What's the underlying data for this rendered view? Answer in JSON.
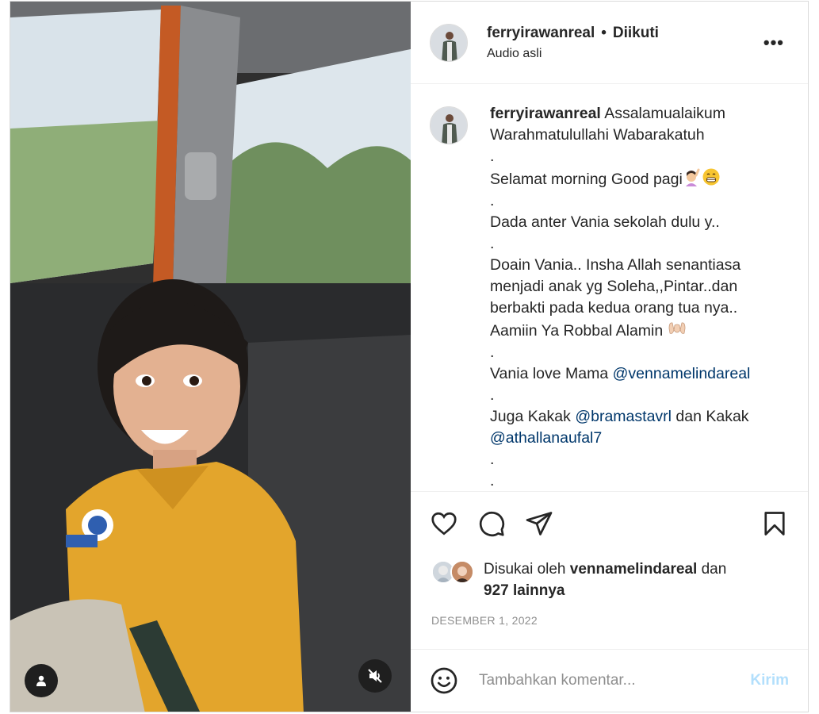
{
  "header": {
    "username": "ferryirawanreal",
    "separator": "•",
    "follow_label": "Diikuti",
    "subtitle": "Audio asli",
    "more_label": "•••"
  },
  "caption": {
    "username": "ferryirawanreal",
    "line1": "Assalamualaikum",
    "line2": "Warahmatulullahi Wabarakatuh",
    "dot1": ".",
    "line3": "Selamat morning Good pagi",
    "dot2": ".",
    "line4": "Dada anter Vania sekolah dulu y..",
    "dot3": ".",
    "line5": "Doain Vania.. Insha Allah senantiasa",
    "line6": "menjadi anak yg Soleha,,Pintar..dan",
    "line7": "berbakti pada kedua orang tua nya..",
    "line8": "Aamiin Ya Robbal Alamin",
    "dot4": ".",
    "line9_prefix": "Vania love Mama ",
    "mention1": "@vennamelindareal",
    "dot5": ".",
    "line10_prefix": "Juga Kakak ",
    "mention2": "@bramastavrl",
    "line10_mid": " dan Kakak",
    "mention3": "@athallanaufal7",
    "dot6": ".",
    "dot7": "."
  },
  "icons": {
    "like": "heart-icon",
    "comment": "comment-icon",
    "share": "share-icon",
    "save": "bookmark-icon",
    "tag": "user-tag-icon",
    "mute": "volume-off-icon",
    "emoji": "smiley-icon"
  },
  "likes": {
    "prefix": "Disukai oleh ",
    "user": "vennamelindareal",
    "mid": " dan",
    "count": "927 lainnya"
  },
  "date": "DESEMBER 1, 2022",
  "comment": {
    "placeholder": "Tambahkan komentar...",
    "post_label": "Kirim"
  },
  "colors": {
    "link": "#00376b",
    "post_button_disabled": "#b2dffc",
    "muted_text": "#8e8e8e"
  }
}
